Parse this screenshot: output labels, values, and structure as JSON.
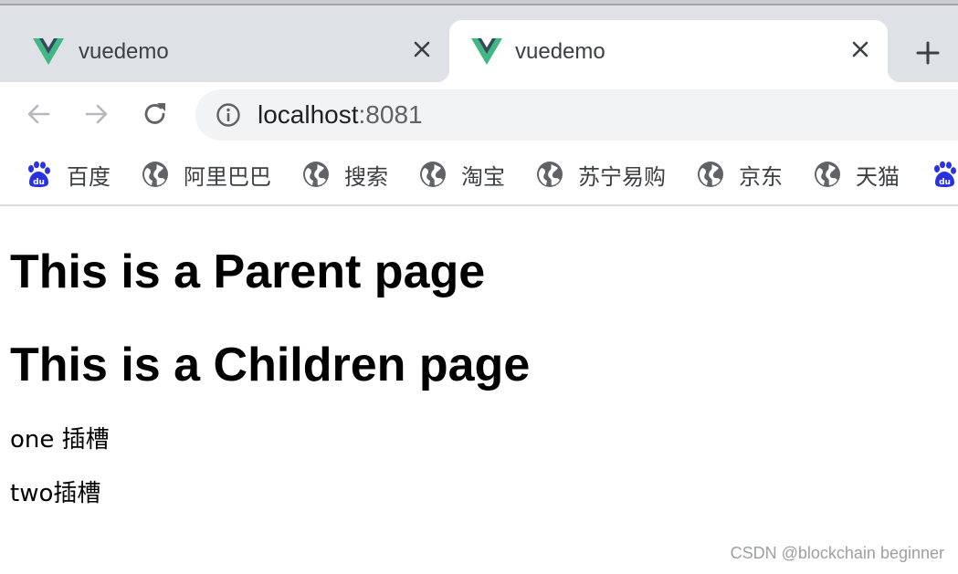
{
  "browser": {
    "tabs": [
      {
        "title": "vuedemo",
        "active": false,
        "favicon": "vue-logo-icon"
      },
      {
        "title": "vuedemo",
        "active": true,
        "favicon": "vue-logo-icon"
      }
    ],
    "new_tab_icon": "plus-icon",
    "close_icon": "close-icon",
    "url": {
      "host": "localhost",
      "port": ":8081"
    },
    "nav_icons": [
      "back-arrow-icon",
      "forward-arrow-icon",
      "reload-icon",
      "info-icon"
    ],
    "bookmarks": [
      {
        "label": "百度",
        "icon": "baidu-paw-icon"
      },
      {
        "label": "阿里巴巴",
        "icon": "globe-icon"
      },
      {
        "label": "搜索",
        "icon": "globe-icon"
      },
      {
        "label": "淘宝",
        "icon": "globe-icon"
      },
      {
        "label": "苏宁易购",
        "icon": "globe-icon"
      },
      {
        "label": "京东",
        "icon": "globe-icon"
      },
      {
        "label": "天猫",
        "icon": "globe-icon"
      },
      {
        "label": "",
        "icon": "baidu-paw-icon"
      }
    ]
  },
  "page": {
    "parent_heading": "This is a Parent page",
    "child_heading": "This is a Children page",
    "slot_one": "one 插槽",
    "slot_two": "two插槽"
  },
  "watermark": "CSDN @blockchain beginner",
  "colors": {
    "tabstrip": "#dee1e6",
    "vue_green": "#41b883",
    "vue_dark": "#34495e",
    "baidu_blue": "#2932e1",
    "globe_gray": "#5f6368"
  }
}
